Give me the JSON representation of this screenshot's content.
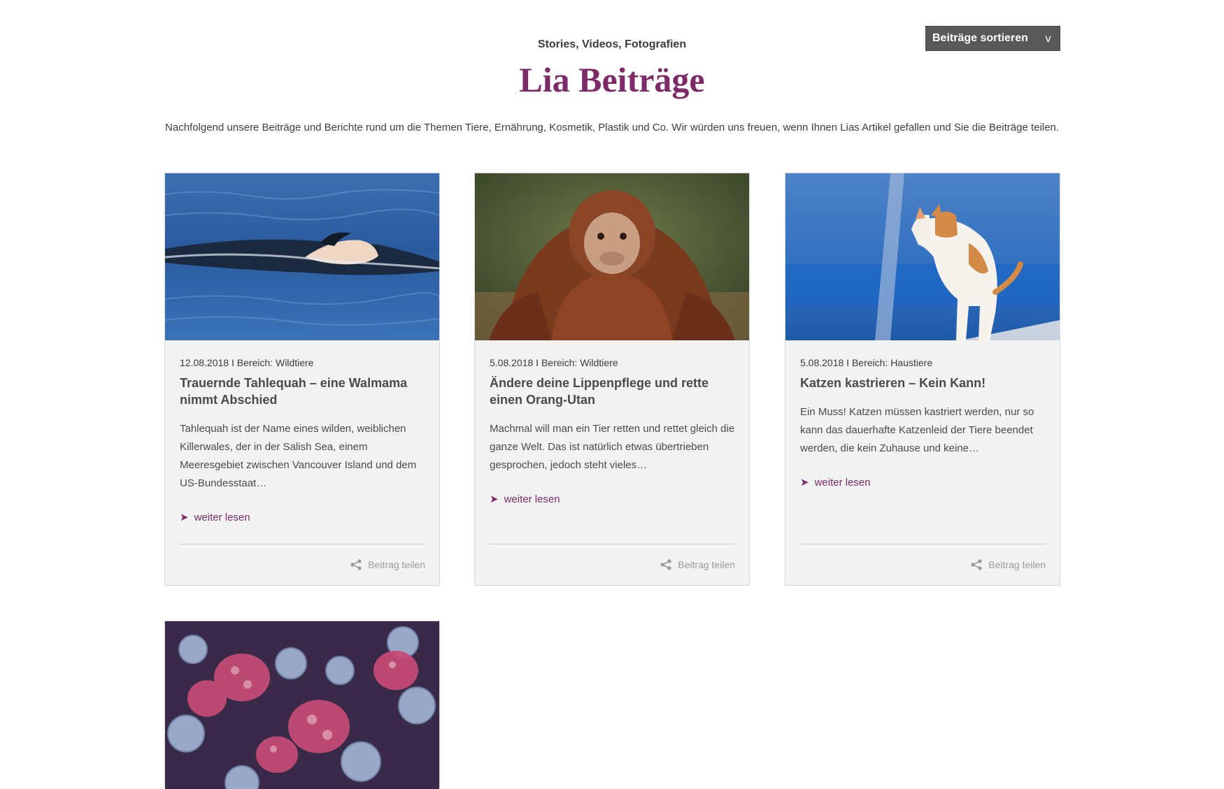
{
  "header": {
    "sort_label": "Beiträge sortieren",
    "sort_chevron": "v",
    "kicker": "Stories, Videos, Fotografien",
    "title": "Lia Beiträge",
    "intro": "Nachfolgend unsere Beiträge und Berichte rund um die Themen Tiere, Ernährung, Kosmetik, Plastik und Co. Wir würden uns freuen, wenn Ihnen Lias Artikel gefallen und Sie die Beiträge teilen."
  },
  "posts": [
    {
      "meta": "12.08.2018 I Bereich: Wildtiere",
      "title": "Trauernde Tahlequah – eine Walmama nimmt Abschied",
      "excerpt": "Tahlequah ist der Name eines wilden, weiblichen Killerwales, der in der Salish Sea, einem Meeresgebiet zwischen Vancouver Island und dem US-Bundesstaat…",
      "more": "weiter lesen",
      "share": "Beitrag teilen",
      "image_icon": "orca-photo"
    },
    {
      "meta": "5.08.2018 I Bereich: Wildtiere",
      "title": "Ändere deine Lippenpflege und rette einen Orang-Utan",
      "excerpt": "Machmal will man ein Tier retten und rettet gleich die ganze Welt. Das ist natürlich etwas übertrieben gesprochen, jedoch steht vieles…",
      "more": "weiter lesen",
      "share": "Beitrag teilen",
      "image_icon": "orangutan-photo"
    },
    {
      "meta": "5.08.2018 I Bereich: Haustiere",
      "title": "Katzen kastrieren – Kein Kann!",
      "excerpt": "Ein Muss! Katzen müssen kastriert werden, nur so kann das dauerhafte Katzenleid der Tiere beendet werden, die kein Zuhause und keine…",
      "more": "weiter lesen",
      "share": "Beitrag teilen",
      "image_icon": "cat-photo"
    },
    {
      "image_icon": "frozen-berries-photo"
    }
  ],
  "colors": {
    "accent": "#7d2a68",
    "card_bg": "#f3f3f3",
    "sort_bg": "#585858"
  }
}
